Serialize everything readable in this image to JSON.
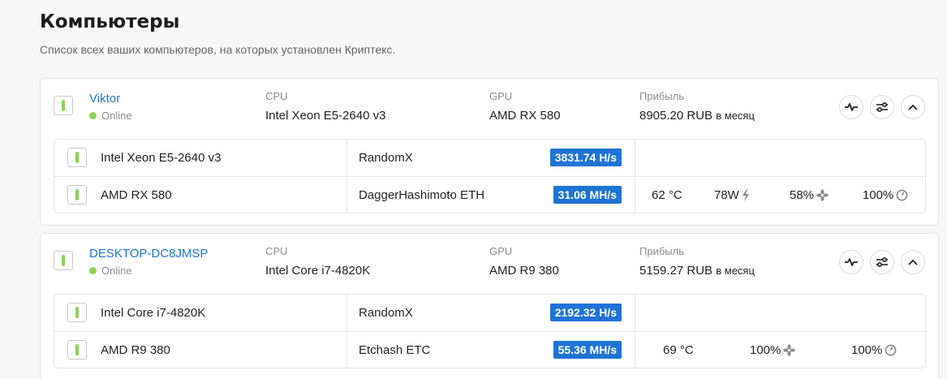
{
  "header": {
    "title": "Компьютеры",
    "subtitle": "Список всех ваших компьютеров, на которых установлен Криптекс."
  },
  "labels": {
    "cpu": "CPU",
    "gpu": "GPU",
    "profit": "Прибыль"
  },
  "computers": [
    {
      "name": "Viktor",
      "status": "Online",
      "cpu": "Intel Xeon E5-2640 v3",
      "gpu": "AMD RX 580",
      "profit": "8905.20 RUB",
      "profit_unit": "в месяц",
      "devices": [
        {
          "name": "Intel Xeon E5-2640 v3",
          "algorithm": "RandomX",
          "hashrate": "3831.74 H/s"
        },
        {
          "name": "AMD RX 580",
          "algorithm": "DaggerHashimoto ETH",
          "hashrate": "31.06 MH/s",
          "temp": "62 °C",
          "power": "78W",
          "fan": "58%",
          "load": "100%"
        }
      ]
    },
    {
      "name": "DESKTOP-DC8JMSP",
      "status": "Online",
      "cpu": "Intel Core i7-4820K",
      "gpu": "AMD R9 380",
      "profit": "5159.27 RUB",
      "profit_unit": "в месяц",
      "devices": [
        {
          "name": "Intel Core i7-4820K",
          "algorithm": "RandomX",
          "hashrate": "2192.32 H/s"
        },
        {
          "name": "AMD R9 380",
          "algorithm": "Etchash ETC",
          "hashrate": "55.36 MH/s",
          "temp": "69 °C",
          "fan": "100%",
          "load": "100%"
        }
      ]
    }
  ],
  "icons": [
    "activity-icon",
    "sliders-icon",
    "chevron-up-icon",
    "bolt-icon",
    "fan-icon",
    "gauge-icon"
  ],
  "colors": {
    "accent": "#1e73d6",
    "online": "#8ed259"
  }
}
